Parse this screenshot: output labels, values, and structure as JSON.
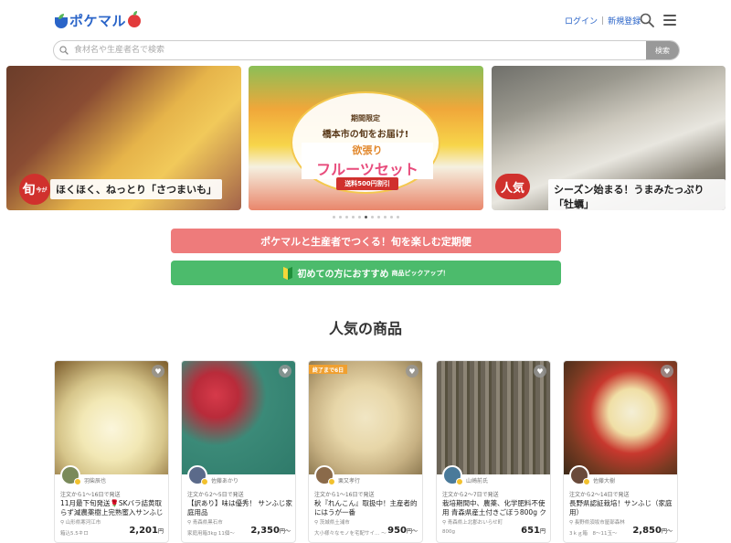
{
  "header": {
    "logo_text": "ポケマル",
    "login": "ログイン",
    "signup": "新規登録"
  },
  "search": {
    "placeholder": "食材名や生産者名で検索",
    "button": "検索"
  },
  "banners": [
    {
      "tag": "旬",
      "tag_sub": "今が",
      "caption": "ほくほく、ねっとり「さつまいも」"
    },
    {
      "sub": "期間限定",
      "tag": "橋本市の旬をお届け!",
      "title_top": "欲張り",
      "title": "フルーツセット",
      "badge": "送料500円割引"
    },
    {
      "tag": "人気",
      "caption": "シーズン始まる！うまみたっぷり「牡蠣」"
    }
  ],
  "carousel": {
    "count": 11,
    "active": 5
  },
  "cta": {
    "subscription": "ポケマルと生産者でつくる！旬を楽しむ定期便",
    "beginner": "初めての方におすすめ",
    "beginner_small": "商品ピックアップ！"
  },
  "section_title": "人気の商品",
  "products": [
    {
      "producer": "羽柴辰也",
      "ship": "注文から1〜16日で発送",
      "name": "11月最下旬発送🌹SKバラ詰黄取らず減農薬樹上完熟蜜入サンふじ訳…",
      "location": "山形県寒河江市",
      "amount": "箱込5.5キロ",
      "price": "2,201",
      "yen": "円",
      "ribbon": ""
    },
    {
      "producer": "佐藤あかり",
      "ship": "注文から2〜5日で発送",
      "name": "【訳あり】味は優秀！ サンふじ家庭用品",
      "location": "青森県黒石市",
      "amount": "家庭用箱3kg 11個～",
      "price": "2,350",
      "yen": "円～",
      "ribbon": ""
    },
    {
      "producer": "栗又孝行",
      "ship": "注文から1〜16日で発送",
      "name": "秋『れんこん』取扱中！主産者的にはうが一番",
      "location": "茨城県土浦市",
      "amount": "大小様々なモノを宅配サイ… ～",
      "price": "950",
      "yen": "円～",
      "ribbon": "終了まで6日"
    },
    {
      "producer": "山崎前氏",
      "ship": "注文から2〜7日で発送",
      "name": "栽培期間中、農薬、化学肥料不使用 青森県産土付きごぼう800g クリ…",
      "location": "青森県上北郡おいらせ町",
      "amount": "800g",
      "price": "651",
      "yen": "円",
      "ribbon": ""
    },
    {
      "producer": "佐藤大樹",
      "ship": "注文から2〜14日で発送",
      "name": "長野県認証栽培！サンふじ（家庭用）",
      "location": "長野県須坂市屋部森林",
      "amount": "3ｋｇ箱　8～11玉～",
      "price": "2,850",
      "yen": "円～",
      "ribbon": ""
    }
  ]
}
